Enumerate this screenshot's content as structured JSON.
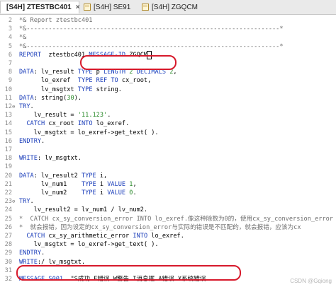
{
  "tabs": [
    {
      "label": "[S4H] ZTESTBC401",
      "close": "×",
      "active": true
    },
    {
      "label": "[S4H] SE91",
      "close": "",
      "active": false
    },
    {
      "label": "[S4H] ZGQCM",
      "close": "",
      "active": false
    }
  ],
  "lines": [
    {
      "n": "2",
      "fold": "",
      "tokens": [
        [
          "cm",
          "*& Report ztestbc401"
        ]
      ]
    },
    {
      "n": "3",
      "fold": "",
      "tokens": [
        [
          "cm",
          "*&---------------------------------------------------------------------*"
        ]
      ]
    },
    {
      "n": "4",
      "fold": "",
      "tokens": [
        [
          "cm",
          "*&"
        ]
      ]
    },
    {
      "n": "5",
      "fold": "",
      "tokens": [
        [
          "cm",
          "*&---------------------------------------------------------------------*"
        ]
      ]
    },
    {
      "n": "6",
      "fold": "",
      "tokens": [
        [
          "kw",
          "REPORT"
        ],
        [
          "",
          "  ztestbc401 "
        ],
        [
          "kw",
          "MESSAGE-ID"
        ],
        [
          "",
          " ZGQCM"
        ],
        [
          "sel",
          "."
        ]
      ]
    },
    {
      "n": "7",
      "fold": "",
      "tokens": [
        [
          "",
          ""
        ]
      ]
    },
    {
      "n": "8",
      "fold": "",
      "tokens": [
        [
          "kw",
          "DATA"
        ],
        [
          "",
          ": lv_result "
        ],
        [
          "kw",
          "TYPE"
        ],
        [
          "",
          " p "
        ],
        [
          "kw",
          "LENGTH"
        ],
        [
          "",
          " "
        ],
        [
          "nm",
          "2"
        ],
        [
          "",
          " "
        ],
        [
          "kw",
          "DECIMALS"
        ],
        [
          "",
          " "
        ],
        [
          "nm",
          "2"
        ],
        [
          "",
          ","
        ]
      ]
    },
    {
      "n": "9",
      "fold": "",
      "tokens": [
        [
          "",
          "      lo_exref  "
        ],
        [
          "kw",
          "TYPE REF TO"
        ],
        [
          "",
          " cx_root,"
        ]
      ]
    },
    {
      "n": "10",
      "fold": "",
      "tokens": [
        [
          "",
          "      lv_msgtxt "
        ],
        [
          "kw",
          "TYPE"
        ],
        [
          "",
          " string."
        ]
      ]
    },
    {
      "n": "11",
      "fold": "",
      "tokens": [
        [
          "kw",
          "DATA"
        ],
        [
          "",
          ": string("
        ],
        [
          "nm",
          "30"
        ],
        [
          "",
          ")."
        ]
      ]
    },
    {
      "n": "12",
      "fold": "⊖",
      "tokens": [
        [
          "kw",
          "TRY"
        ],
        [
          "",
          "."
        ]
      ]
    },
    {
      "n": "13",
      "fold": "",
      "tokens": [
        [
          "",
          "    lv_result = "
        ],
        [
          "st",
          "'11.123'"
        ],
        [
          "",
          "."
        ]
      ]
    },
    {
      "n": "14",
      "fold": "",
      "tokens": [
        [
          "",
          "  "
        ],
        [
          "kw",
          "CATCH"
        ],
        [
          "",
          " cx_root "
        ],
        [
          "kw",
          "INTO"
        ],
        [
          "",
          " lo_exref."
        ]
      ]
    },
    {
      "n": "15",
      "fold": "",
      "tokens": [
        [
          "",
          "    lv_msgtxt = lo_exref->get_text( )."
        ]
      ]
    },
    {
      "n": "16",
      "fold": "",
      "tokens": [
        [
          "kw",
          "ENDTRY"
        ],
        [
          "",
          "."
        ]
      ]
    },
    {
      "n": "17",
      "fold": "",
      "tokens": [
        [
          "",
          ""
        ]
      ]
    },
    {
      "n": "18",
      "fold": "",
      "tokens": [
        [
          "kw",
          "WRITE"
        ],
        [
          "",
          ": lv_msgtxt."
        ]
      ]
    },
    {
      "n": "19",
      "fold": "",
      "tokens": [
        [
          "",
          ""
        ]
      ]
    },
    {
      "n": "20",
      "fold": "",
      "tokens": [
        [
          "kw",
          "DATA"
        ],
        [
          "",
          ": lv_result2 "
        ],
        [
          "kw",
          "TYPE"
        ],
        [
          "",
          " i,"
        ]
      ]
    },
    {
      "n": "21",
      "fold": "",
      "tokens": [
        [
          "",
          "      lv_num1    "
        ],
        [
          "kw",
          "TYPE"
        ],
        [
          "",
          " i "
        ],
        [
          "kw",
          "VALUE"
        ],
        [
          "",
          " "
        ],
        [
          "nm",
          "1"
        ],
        [
          "",
          ","
        ]
      ]
    },
    {
      "n": "22",
      "fold": "",
      "tokens": [
        [
          "",
          "      lv_num2    "
        ],
        [
          "kw",
          "TYPE"
        ],
        [
          "",
          " i "
        ],
        [
          "kw",
          "VALUE"
        ],
        [
          "",
          " "
        ],
        [
          "nm",
          "0"
        ],
        [
          "",
          "."
        ]
      ]
    },
    {
      "n": "23",
      "fold": "⊖",
      "tokens": [
        [
          "kw",
          "TRY"
        ],
        [
          "",
          "."
        ]
      ]
    },
    {
      "n": "24",
      "fold": "",
      "tokens": [
        [
          "",
          "    lv_result2 = lv_num1 / lv_num2."
        ]
      ]
    },
    {
      "n": "25",
      "fold": "",
      "tokens": [
        [
          "cm",
          "*  CATCH cx_sy_conversion_error INTO lo_exref.像这种除数为0的，使用cx_sy_conversion_error"
        ]
      ]
    },
    {
      "n": "26",
      "fold": "",
      "tokens": [
        [
          "cm",
          "*  就会报错，因为设定的cx_sy_conversion_error与实际的错误是不匹配的，就会报错，应该为cx"
        ]
      ]
    },
    {
      "n": "27",
      "fold": "",
      "tokens": [
        [
          "",
          "  "
        ],
        [
          "kw",
          "CATCH"
        ],
        [
          "",
          " cx_sy_arithmetic_error "
        ],
        [
          "kw",
          "INTO"
        ],
        [
          "",
          " lo_exref."
        ]
      ]
    },
    {
      "n": "28",
      "fold": "",
      "tokens": [
        [
          "",
          "    lv_msgtxt = lo_exref->get_text( )."
        ]
      ]
    },
    {
      "n": "29",
      "fold": "",
      "tokens": [
        [
          "kw",
          "ENDTRY"
        ],
        [
          "",
          "."
        ]
      ]
    },
    {
      "n": "30",
      "fold": "",
      "tokens": [
        [
          "kw",
          "WRITE"
        ],
        [
          "",
          ":/ lv_msgtxt."
        ]
      ]
    },
    {
      "n": "31",
      "fold": "",
      "tokens": [
        [
          "",
          ""
        ]
      ]
    },
    {
      "n": "32",
      "fold": "",
      "tokens": [
        [
          "kw",
          "MESSAGE"
        ],
        [
          "",
          " "
        ],
        [
          "kw",
          "S001"
        ],
        [
          "",
          ". \"S成功 E错误 W警告 I消息框 A错误 X系统错误"
        ]
      ]
    }
  ],
  "watermark": "CSDN @Gqiong",
  "colors": {
    "keyword": "#1a3dba",
    "comment": "#6e6e6e",
    "literal": "#2a8a2a",
    "annotation": "#d7192b"
  }
}
